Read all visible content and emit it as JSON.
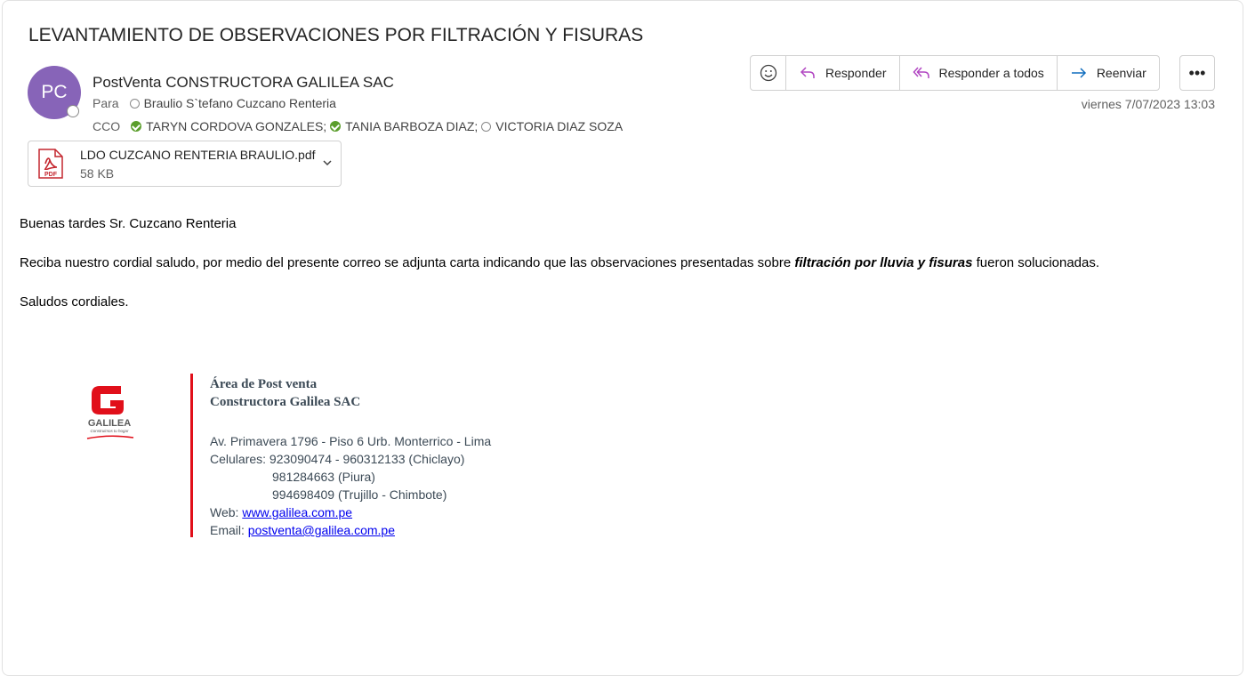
{
  "email": {
    "subject": "LEVANTAMIENTO DE OBSERVACIONES POR FILTRACIÓN Y FISURAS",
    "avatar_initials": "PC",
    "sender": "PostVenta CONSTRUCTORA GALILEA SAC",
    "to_label": "Para",
    "to": "Braulio S`tefano Cuzcano Renteria",
    "bcc_label": "CCO",
    "bcc": [
      {
        "name": "TARYN CORDOVA GONZALES;",
        "status": "available"
      },
      {
        "name": "TANIA BARBOZA DIAZ;",
        "status": "available"
      },
      {
        "name": "VICTORIA DIAZ SOZA",
        "status": "unknown"
      }
    ],
    "date": "viernes 7/07/2023 13:03"
  },
  "attachment": {
    "name": "LDO CUZCANO RENTERIA BRAULIO.pdf",
    "size": "58 KB",
    "icon_label": "PDF"
  },
  "actions": {
    "reply": "Responder",
    "reply_all": "Responder a todos",
    "forward": "Reenviar",
    "more": "•••"
  },
  "body": {
    "greeting": "Buenas tardes Sr. Cuzcano Renteria",
    "para_before": "Reciba nuestro cordial saludo, por medio del presente correo se adjunta carta indicando que las observaciones presentadas sobre ",
    "para_emph": "filtración por lluvia y fisuras",
    "para_after": " fueron solucionadas.",
    "closing": "Saludos cordiales."
  },
  "signature": {
    "logo_text": "GALILEA",
    "logo_tagline": "Construimos tu hogar",
    "dept": "Área de Post venta",
    "company": "Constructora Galilea SAC",
    "address": "Av. Primavera 1796 - Piso 6 Urb. Monterrico - Lima",
    "phones_label": "Celulares:",
    "phone1": "923090474 - 960312133 (Chiclayo)",
    "phone2": "981284663 (Piura)",
    "phone3": "994698409 (Trujillo - Chimbote)",
    "web_label": "Web:",
    "web": "www.galilea.com.pe",
    "email_label": "Email:",
    "email": "postventa@galilea.com.pe"
  },
  "colors": {
    "avatar": "#8764b8",
    "reply_icon": "#b146c2",
    "forward_icon": "#0f6cbd",
    "brand_red": "#e10f1a"
  }
}
